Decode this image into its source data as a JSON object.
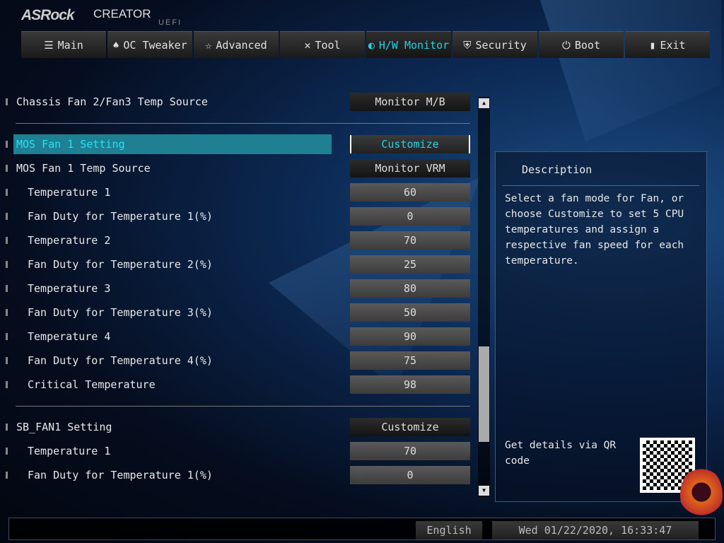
{
  "brand": {
    "logo": "ASRock",
    "product": "CREATOR",
    "sub": "UEFI"
  },
  "tabs": [
    {
      "label": "Main",
      "icon": "list-icon",
      "glyph": "☰"
    },
    {
      "label": "OC Tweaker",
      "icon": "rocket-icon",
      "glyph": "♠"
    },
    {
      "label": "Advanced",
      "icon": "star-icon",
      "glyph": "☆"
    },
    {
      "label": "Tool",
      "icon": "tools-icon",
      "glyph": "✕"
    },
    {
      "label": "H/W Monitor",
      "icon": "monitor-icon",
      "glyph": "◐",
      "active": true
    },
    {
      "label": "Security",
      "icon": "shield-icon",
      "glyph": "⛨"
    },
    {
      "label": "Boot",
      "icon": "power-icon",
      "glyph": "⏻"
    },
    {
      "label": "Exit",
      "icon": "exit-icon",
      "glyph": "▮"
    }
  ],
  "settings": [
    {
      "label": "Chassis Fan 2/Fan3 Temp Source",
      "value": "Monitor M/B",
      "dark": true
    },
    {
      "label": "MOS Fan 1 Setting",
      "value": "Customize",
      "selected": true
    },
    {
      "label": "MOS Fan 1 Temp Source",
      "value": "Monitor VRM",
      "dark": true
    },
    {
      "label": "Temperature 1",
      "value": "60",
      "sub": true
    },
    {
      "label": "Fan Duty for Temperature 1(%)",
      "value": "0",
      "sub": true
    },
    {
      "label": "Temperature 2",
      "value": "70",
      "sub": true
    },
    {
      "label": "Fan Duty for Temperature 2(%)",
      "value": "25",
      "sub": true
    },
    {
      "label": "Temperature 3",
      "value": "80",
      "sub": true
    },
    {
      "label": "Fan Duty for Temperature 3(%)",
      "value": "50",
      "sub": true
    },
    {
      "label": "Temperature 4",
      "value": "90",
      "sub": true
    },
    {
      "label": "Fan Duty for Temperature 4(%)",
      "value": "75",
      "sub": true
    },
    {
      "label": "Critical Temperature",
      "value": "98",
      "sub": true
    },
    {
      "label": "SB_FAN1 Setting",
      "value": "Customize",
      "dark": true
    },
    {
      "label": "Temperature 1",
      "value": "70",
      "sub": true
    },
    {
      "label": "Fan Duty for Temperature 1(%)",
      "value": "0",
      "sub": true
    }
  ],
  "description": {
    "title": "Description",
    "text": "Select a fan mode for Fan, or choose Customize to set 5 CPU temperatures and assign a respective fan speed for each temperature.",
    "qr_text": "Get details via QR code"
  },
  "footer": {
    "language": "English",
    "datetime": "Wed 01/22/2020, 16:33:47"
  },
  "colors": {
    "accent": "#22d3e6",
    "selected_row": "#1f7f93"
  }
}
